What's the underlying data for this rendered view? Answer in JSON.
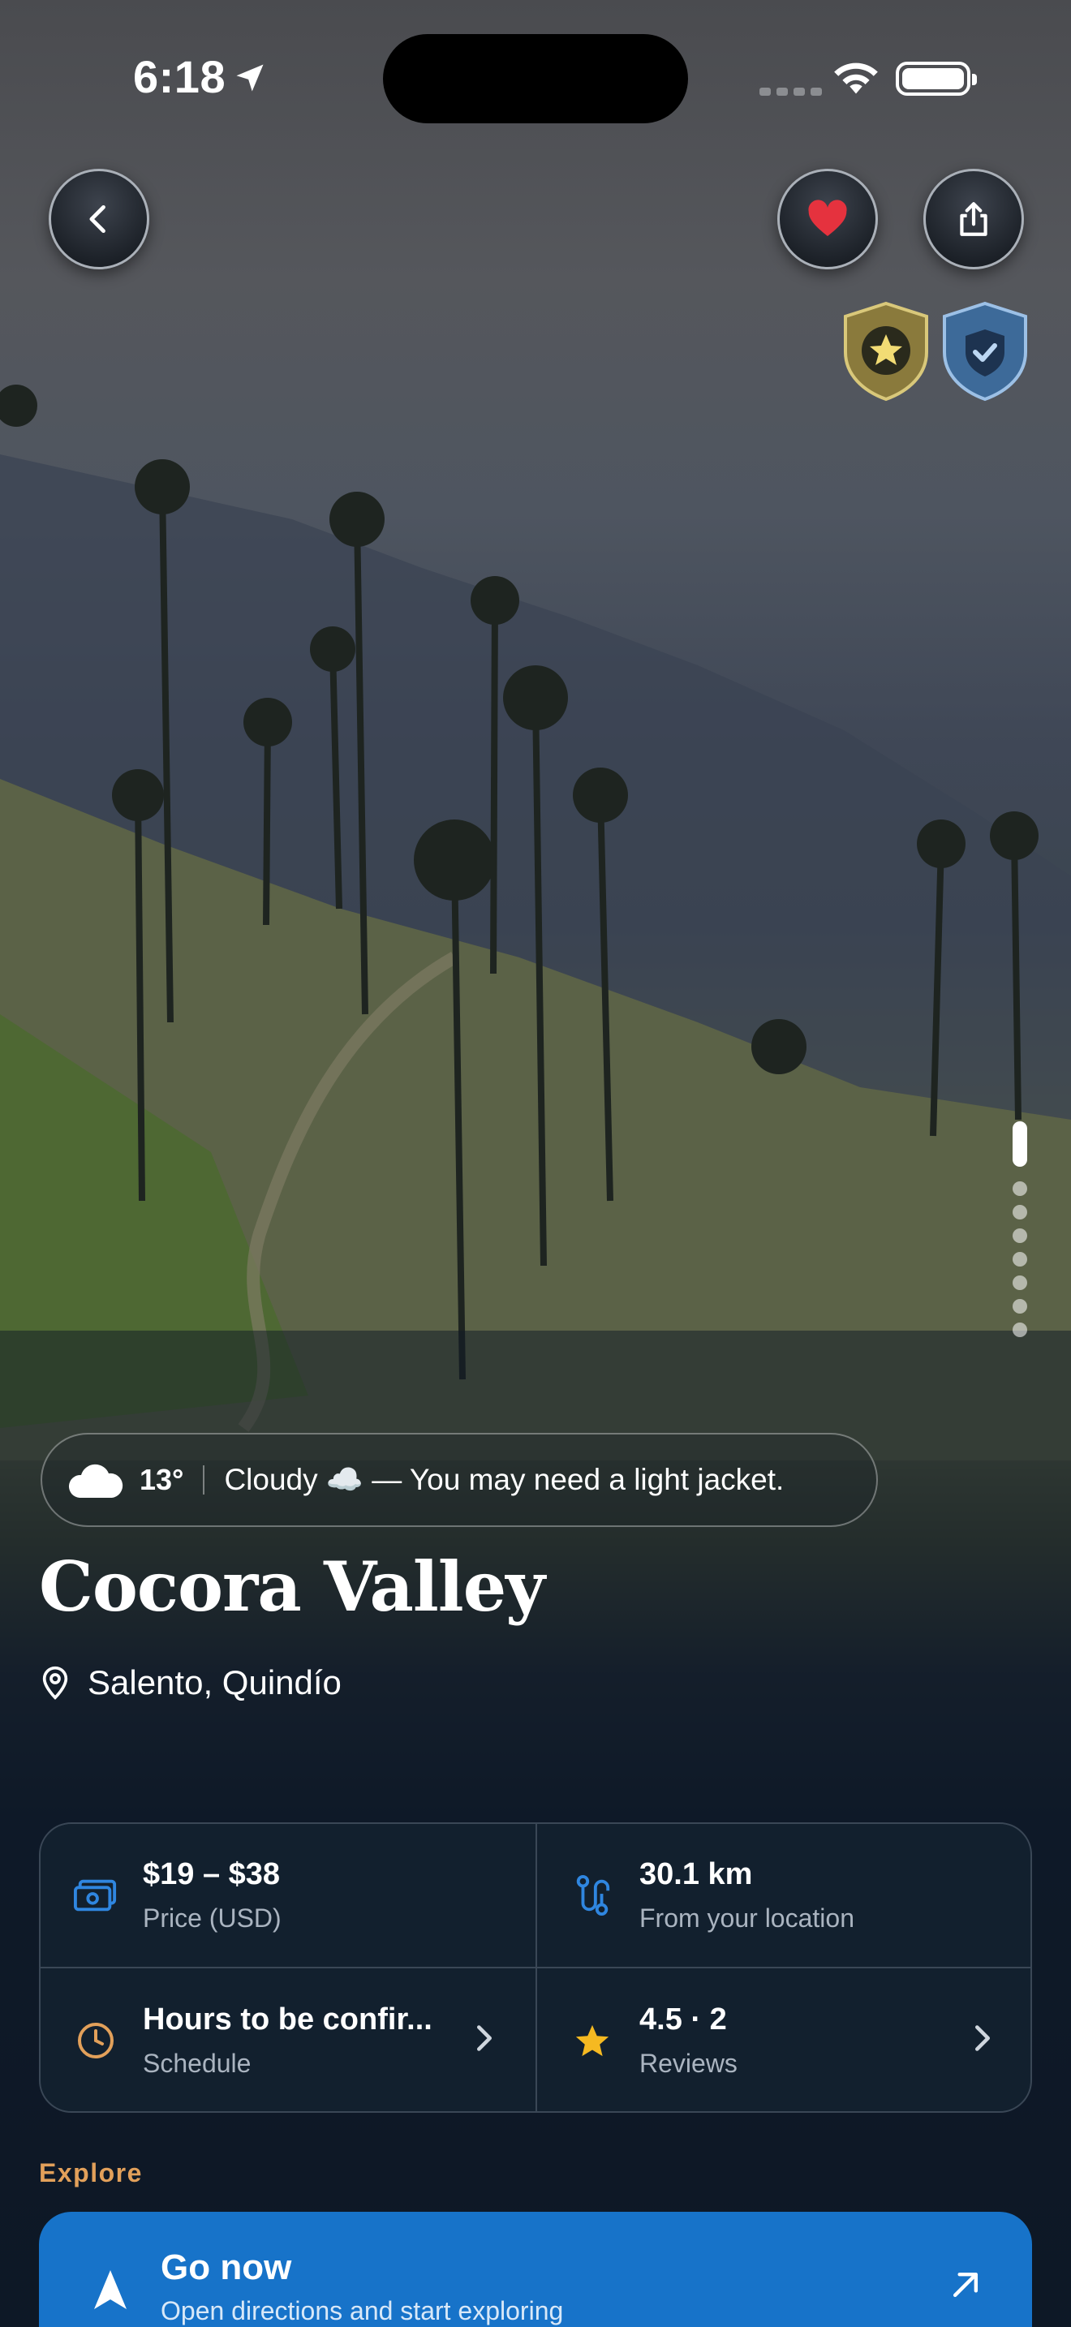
{
  "status_bar": {
    "time": "6:18"
  },
  "badges": [
    "star-badge",
    "shield-check-badge"
  ],
  "pager": {
    "total": 8,
    "active_index": 0
  },
  "weather": {
    "temperature": "13°",
    "description": "Cloudy ☁️ — You may need a light jacket."
  },
  "place": {
    "title": "Cocora Valley",
    "location": "Salento, Quindío"
  },
  "info": {
    "price": {
      "value": "$19 – $38",
      "label": "Price  (USD)"
    },
    "distance": {
      "value": "30.1 km",
      "label": "From your location"
    },
    "schedule": {
      "value": "Hours to be confir...",
      "label": "Schedule"
    },
    "reviews": {
      "value": "4.5 · 2",
      "label": "Reviews"
    }
  },
  "explore": {
    "heading": "Explore",
    "go_now": {
      "title": "Go now",
      "subtitle": "Open directions and start exploring"
    }
  },
  "colors": {
    "accent_blue": "#1773c9",
    "explore_orange": "#e2a05a",
    "favorite_red": "#e5323e",
    "card_bg": "#12202e"
  }
}
